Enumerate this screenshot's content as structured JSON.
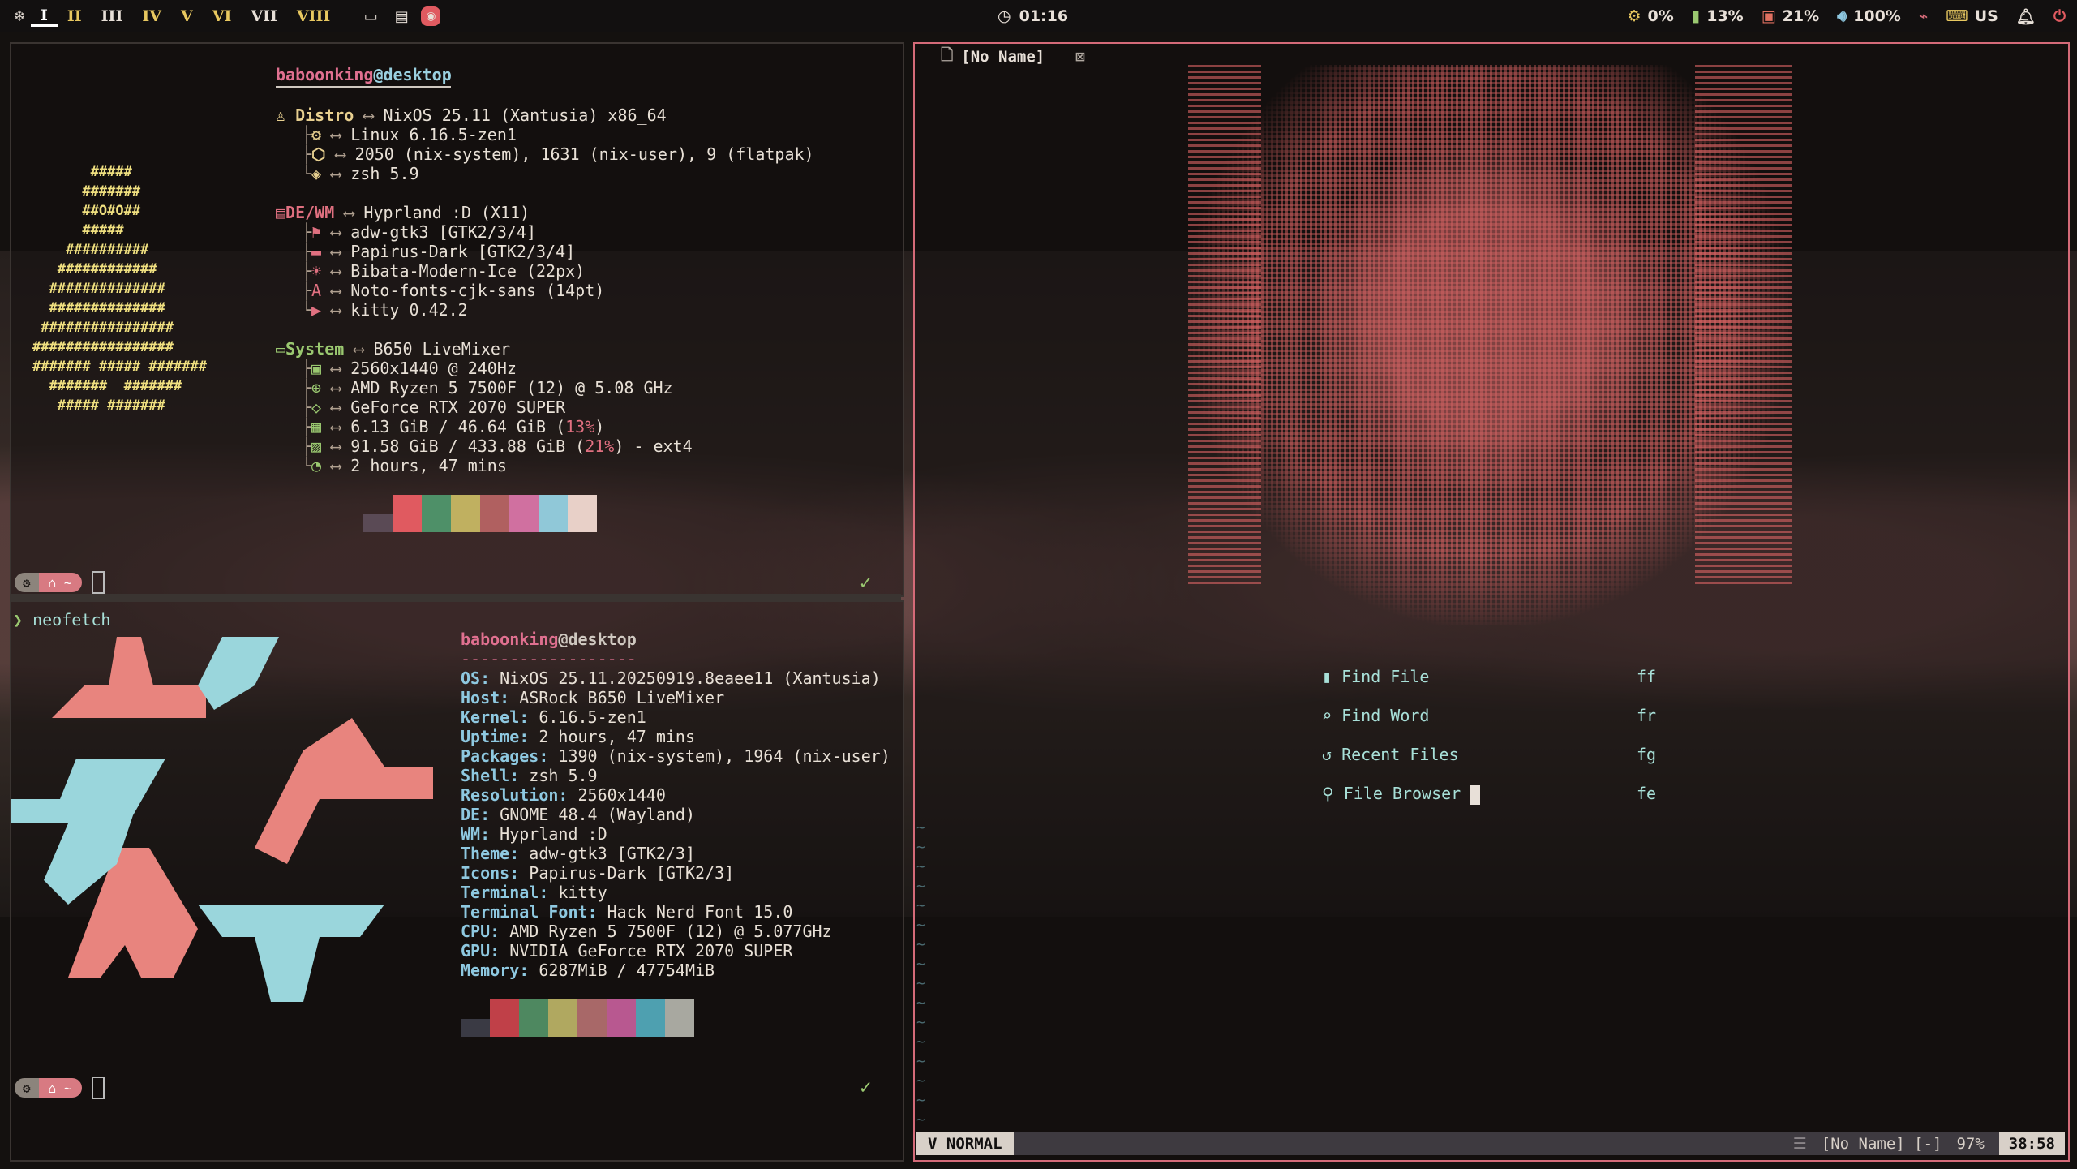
{
  "topbar": {
    "workspaces": [
      "I",
      "II",
      "III",
      "IV",
      "V",
      "VI",
      "VII",
      "VIII"
    ],
    "active_workspace": "I",
    "clock": "01:16",
    "cpu": "0%",
    "battery1": "13%",
    "battery2": "21%",
    "volume": "100%",
    "keyboard": "US"
  },
  "fetch1": {
    "user": "baboonking",
    "at_host": "@desktop",
    "distro_label": "Distro",
    "distro_value": "NixOS 25.11 (Xantusia) x86_64",
    "kernel": "Linux 6.16.5-zen1",
    "packages": "2050 (nix-system), 1631 (nix-user), 9 (flatpak)",
    "shell": "zsh 5.9",
    "dewm_label": "DE/WM",
    "dewm_value": "Hyprland :D (X11)",
    "gtk_theme": "adw-gtk3 [GTK2/3/4]",
    "icons": "Papirus-Dark [GTK2/3/4]",
    "cursor": "Bibata-Modern-Ice (22px)",
    "font": "Noto-fonts-cjk-sans (14pt)",
    "terminal": "kitty 0.42.2",
    "system_label": "System",
    "system_value": "B650 LiveMixer",
    "display": "2560x1440 @ 240Hz",
    "cpu": "AMD Ryzen 5 7500F (12) @ 5.08 GHz",
    "gpu": "GeForce RTX 2070 SUPER",
    "memory_pre": "6.13 GiB / 46.64 GiB (",
    "memory_pct": "13%",
    "memory_post": ")",
    "disk_pre": "91.58 GiB / 433.88 GiB (",
    "disk_pct": "21%",
    "disk_post": ") - ext4",
    "uptime": "2 hours, 47 mins",
    "arrow": "⟷",
    "ascii_logo": "       #####\n      #######\n      ##O#O##\n      #####\n    ##########\n   ############\n  ##############\n  ##############\n ################\n#################\n####### ##### #######\n  #######  #######\n   ##### #######"
  },
  "prompt1": {
    "home": "~"
  },
  "fetch2": {
    "command_prompt": "❯",
    "command": "neofetch",
    "user": "baboonking",
    "at_host": "@desktop",
    "rule": "------------------",
    "rows": [
      {
        "key": "OS:",
        "value": " NixOS 25.11.20250919.8eaee11 (Xantusia)"
      },
      {
        "key": "Host:",
        "value": " ASRock B650 LiveMixer"
      },
      {
        "key": "Kernel:",
        "value": " 6.16.5-zen1"
      },
      {
        "key": "Uptime:",
        "value": " 2 hours, 47 mins"
      },
      {
        "key": "Packages:",
        "value": " 1390 (nix-system), 1964 (nix-user)"
      },
      {
        "key": "Shell:",
        "value": " zsh 5.9"
      },
      {
        "key": "Resolution:",
        "value": " 2560x1440"
      },
      {
        "key": "DE:",
        "value": " GNOME 48.4 (Wayland)"
      },
      {
        "key": "WM:",
        "value": " Hyprland :D"
      },
      {
        "key": "Theme:",
        "value": " adw-gtk3 [GTK2/3]"
      },
      {
        "key": "Icons:",
        "value": " Papirus-Dark [GTK2/3]"
      },
      {
        "key": "Terminal:",
        "value": " kitty"
      },
      {
        "key": "Terminal Font:",
        "value": " Hack Nerd Font 15.0"
      },
      {
        "key": "CPU:",
        "value": " AMD Ryzen 5 7500F (12) @ 5.077GHz"
      },
      {
        "key": "GPU:",
        "value": " NVIDIA GeForce RTX 2070 SUPER"
      },
      {
        "key": "Memory:",
        "value": " 6287MiB / 47754MiB"
      }
    ]
  },
  "prompt2": {
    "home": "~"
  },
  "nvim": {
    "tab_title": "[No Name]",
    "dashboard": [
      {
        "label": "Find File",
        "key": "ff"
      },
      {
        "label": "Find Word",
        "key": "fr"
      },
      {
        "label": "Recent Files",
        "key": "fg"
      },
      {
        "label": "File Browser",
        "key": "fe"
      }
    ],
    "mode": "NORMAL",
    "file_status": "[No Name] [-]",
    "percent": "97%",
    "position": "38:58",
    "tilde": "~"
  },
  "colors": {
    "accent": "#d46a78",
    "swatches1": [
      "#5a4a55",
      "#e05a60",
      "#4e9068",
      "#c0b060",
      "#b06060",
      "#d070a0",
      "#90c8d8",
      "#e8d0c8"
    ],
    "swatches2": [
      "#3a3a44",
      "#c04048",
      "#4e8860",
      "#b0a860",
      "#a86868",
      "#b85890",
      "#4ea0b0",
      "#a8a8a0"
    ]
  }
}
